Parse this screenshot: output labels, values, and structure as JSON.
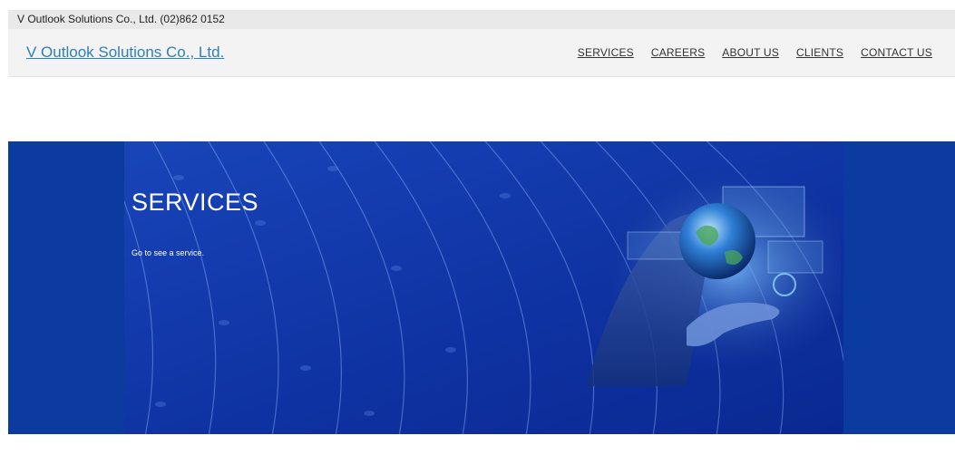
{
  "topbar": {
    "contact": "V Outlook Solutions Co., Ltd. (02)862 0152"
  },
  "header": {
    "brand": "V Outlook Solutions Co., Ltd.",
    "nav": [
      {
        "label": "SERVICES"
      },
      {
        "label": "CAREERS"
      },
      {
        "label": "ABOUT US"
      },
      {
        "label": "CLIENTS"
      },
      {
        "label": "CONTACT US"
      }
    ]
  },
  "hero": {
    "title": "SERVICES",
    "subtitle": "Go to see a service.",
    "image_icon": "globe-in-hand-icon"
  },
  "colors": {
    "hero_background": "#0c3ba0",
    "brand_link": "#2f7fb8",
    "topbar_background": "#e9e9e9"
  }
}
